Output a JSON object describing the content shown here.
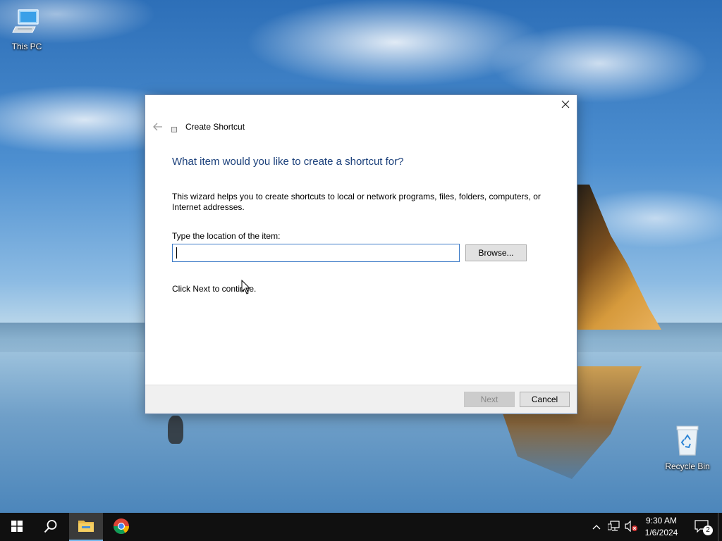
{
  "desktop": {
    "icons": [
      {
        "label": "This PC"
      },
      {
        "label": "Recycle Bin"
      }
    ]
  },
  "dialog": {
    "title": "Create Shortcut",
    "heading": "What item would you like to create a shortcut for?",
    "description": "This wizard helps you to create shortcuts to local or network programs, files, folders, computers, or Internet addresses.",
    "location_label": "Type the location of the item:",
    "location_value": "",
    "browse_label": "Browse...",
    "continue_text": "Click Next to continue.",
    "next_label": "Next",
    "cancel_label": "Cancel"
  },
  "taskbar": {
    "time": "9:30 AM",
    "date": "1/6/2024",
    "notification_count": "2",
    "pinned": [
      "start-icon",
      "search-icon",
      "file-explorer-icon",
      "chrome-icon"
    ]
  },
  "colors": {
    "heading": "#1a3f7a",
    "input_border": "#3d7bc7",
    "taskbar": "#101010"
  }
}
